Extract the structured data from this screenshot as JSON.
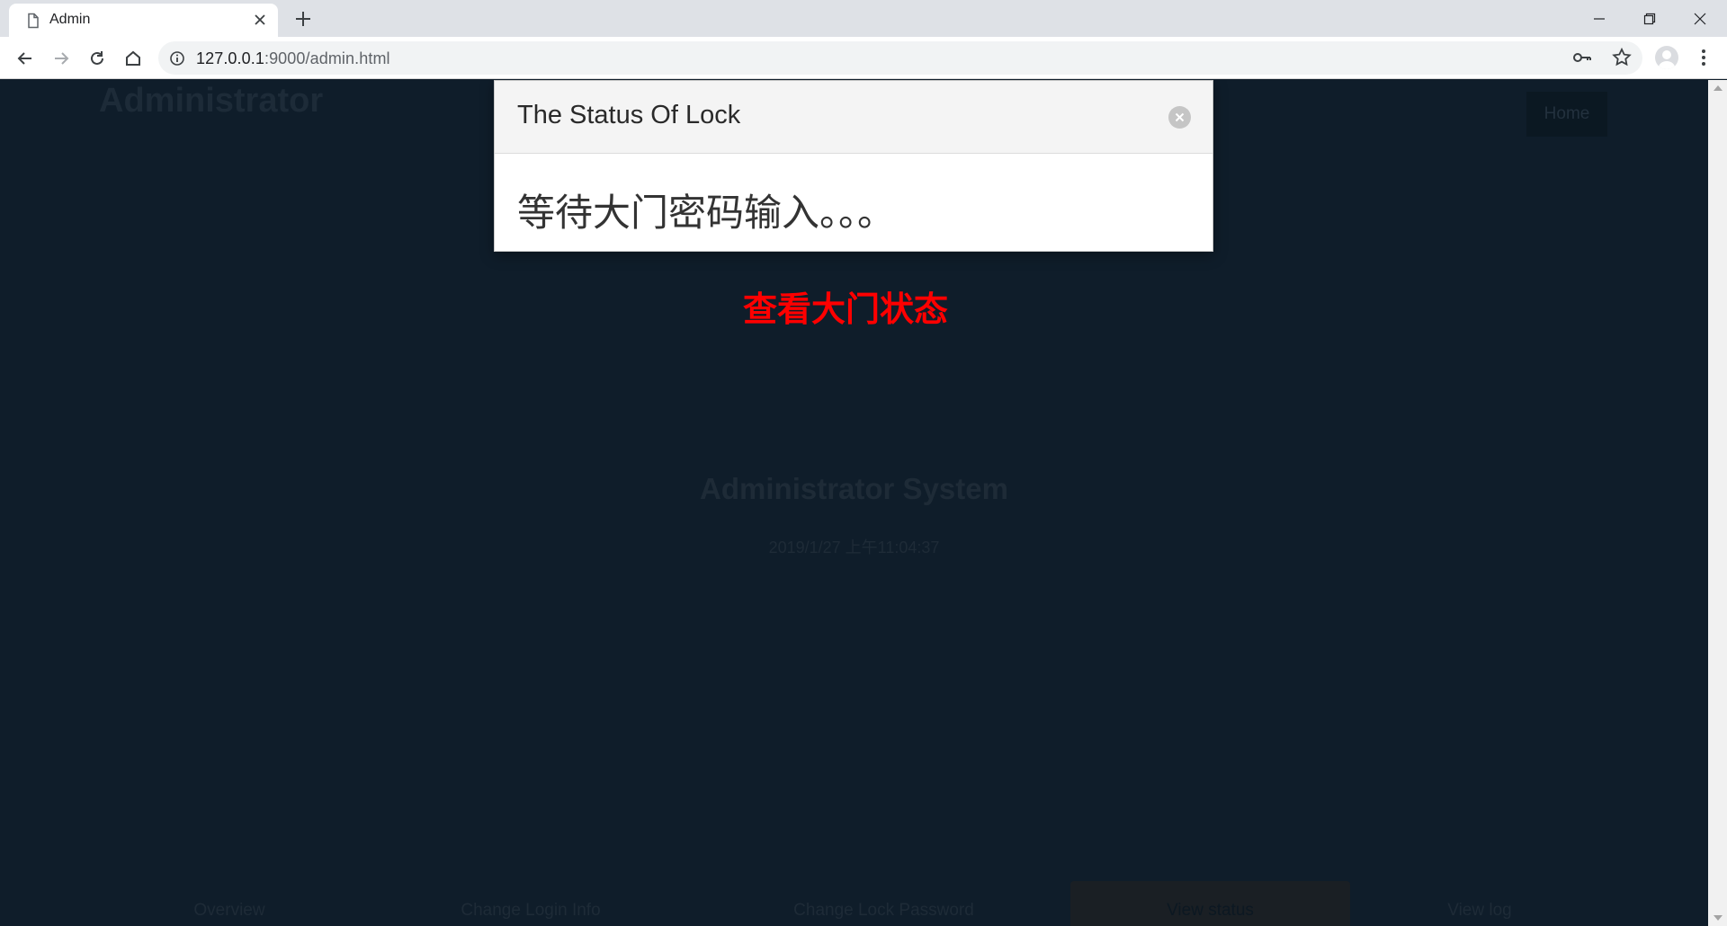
{
  "browser": {
    "tab_title": "Admin",
    "url_host": "127.0.0.1",
    "url_path": ":9000/admin.html"
  },
  "page": {
    "brand": "Administrator",
    "home_link": "Home",
    "status_button": "查看大门状态",
    "system_title": "Administrator System",
    "system_time": "2019/1/27 上午11:04:37",
    "bottom_nav": {
      "overview": "Overview",
      "change_login": "Change Login Info",
      "change_lock_password": "Change Lock Password",
      "view_status": "View status",
      "view_log": "View log"
    }
  },
  "modal": {
    "title": "The Status Of Lock",
    "message": "等待大门密码输入。。。"
  },
  "colors": {
    "page_bg": "#0f1d2a",
    "accent_red": "#ff0000",
    "modal_header_bg": "#f4f4f4"
  }
}
